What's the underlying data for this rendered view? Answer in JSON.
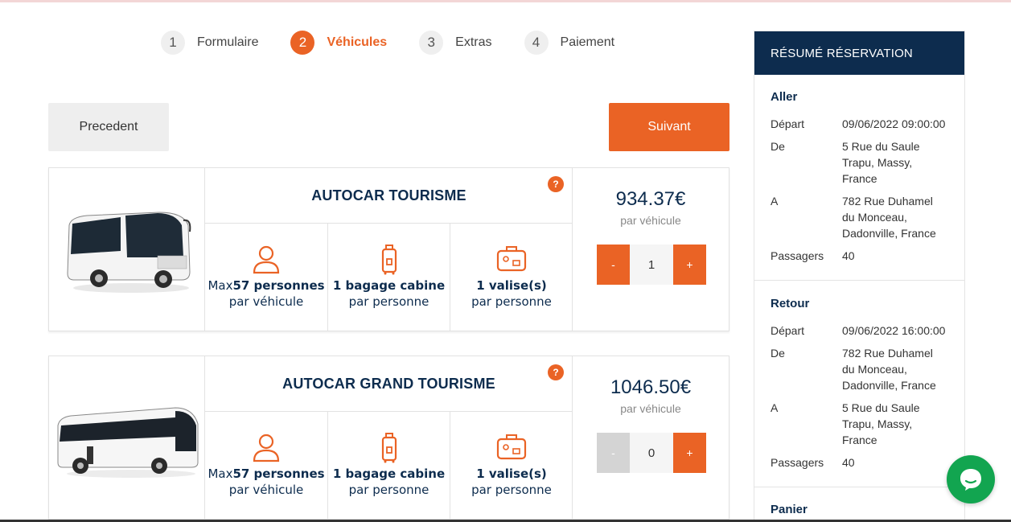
{
  "steps": [
    {
      "num": "1",
      "label": "Formulaire"
    },
    {
      "num": "2",
      "label": "Véhicules"
    },
    {
      "num": "3",
      "label": "Extras"
    },
    {
      "num": "4",
      "label": "Paiement"
    }
  ],
  "buttons": {
    "prev": "Precedent",
    "next": "Suivant"
  },
  "vehicles": [
    {
      "title": "AUTOCAR TOURISME",
      "help": "?",
      "capacity_prefix": "Max",
      "capacity_bold": "57 personnes",
      "capacity_sub": "par véhicule",
      "cabin_bold": "1 bagage cabine",
      "cabin_sub": "par personne",
      "suitcase_bold": "1 valise(s)",
      "suitcase_sub": "par personne",
      "price": "934.37€",
      "price_unit": "par véhicule",
      "minus": "-",
      "quantity": "1",
      "plus": "+"
    },
    {
      "title": "AUTOCAR GRAND TOURISME",
      "help": "?",
      "capacity_prefix": "Max",
      "capacity_bold": "57 personnes",
      "capacity_sub": "par véhicule",
      "cabin_bold": "1 bagage cabine",
      "cabin_sub": "par personne",
      "suitcase_bold": "1 valise(s)",
      "suitcase_sub": "par personne",
      "price": "1046.50€",
      "price_unit": "par véhicule",
      "minus": "-",
      "quantity": "0",
      "plus": "+"
    }
  ],
  "summary": {
    "header": "RÉSUMÉ RÉSERVATION",
    "aller": {
      "title": "Aller",
      "depart_label": "Départ",
      "depart": "09/06/2022 09:00:00",
      "de_label": "De",
      "de_lines": [
        "5 Rue du Saule",
        "Trapu, Massy,",
        "France"
      ],
      "a_label": "A",
      "a_lines": [
        "782 Rue Duhamel",
        "du Monceau,",
        "Dadonville, France"
      ],
      "passagers_label": "Passagers",
      "passagers": "40"
    },
    "retour": {
      "title": "Retour",
      "depart_label": "Départ",
      "depart": "09/06/2022 16:00:00",
      "de_label": "De",
      "de_lines": [
        "782 Rue Duhamel",
        "du Monceau,",
        "Dadonville, France"
      ],
      "a_label": "A",
      "a_lines": [
        "5 Rue du Saule",
        "Trapu, Massy,",
        "France"
      ],
      "passagers_label": "Passagers",
      "passagers": "40"
    },
    "panier_title": "Panier"
  },
  "colors": {
    "accent": "#ea6325",
    "navy": "#0d2c4e",
    "chat": "#12a550"
  },
  "icons": [
    "person-icon",
    "cabin-bag-icon",
    "suitcase-icon",
    "help-icon",
    "chat-icon",
    "bus-image"
  ]
}
